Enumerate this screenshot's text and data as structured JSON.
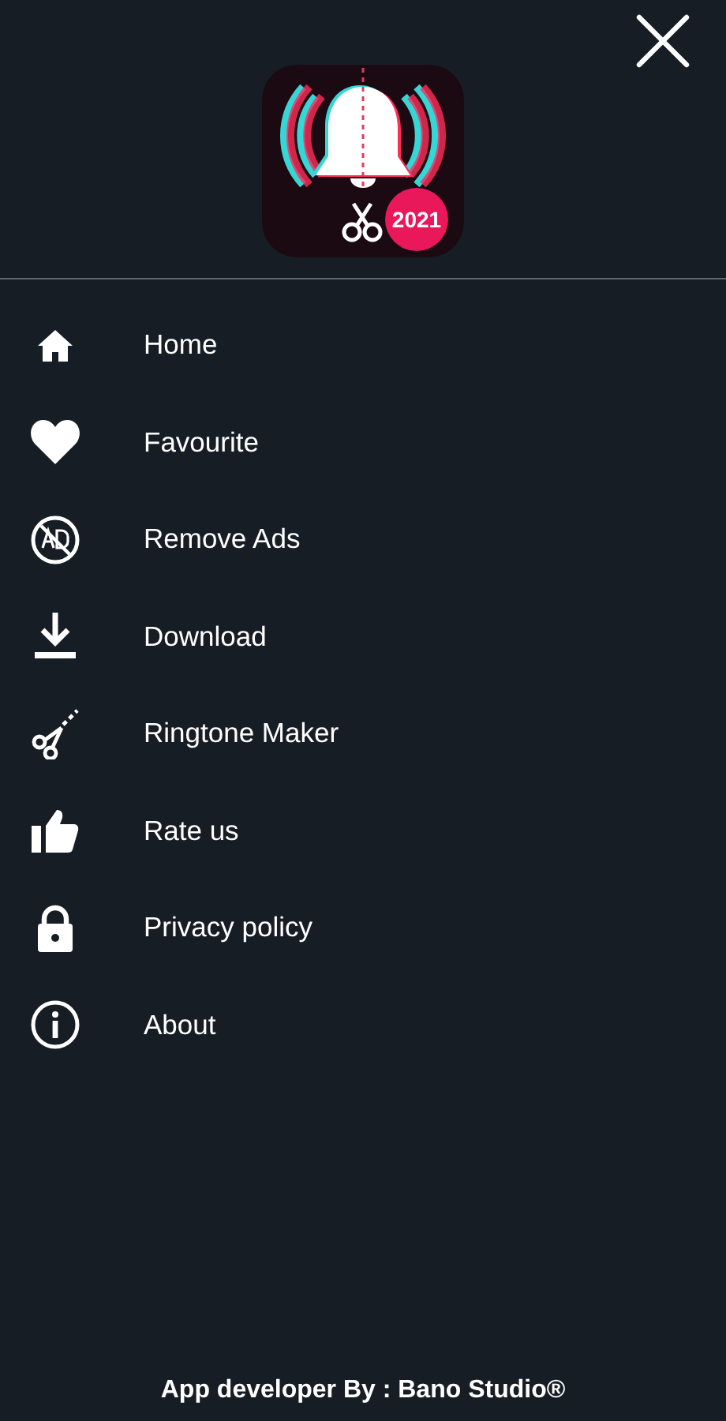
{
  "logo": {
    "badge": "2021"
  },
  "menu": [
    {
      "kind": "home",
      "label": "Home"
    },
    {
      "kind": "heart",
      "label": "Favourite"
    },
    {
      "kind": "noads",
      "label": "Remove Ads"
    },
    {
      "kind": "download",
      "label": "Download"
    },
    {
      "kind": "scissors",
      "label": "Ringtone Maker"
    },
    {
      "kind": "thumb",
      "label": "Rate us"
    },
    {
      "kind": "lock",
      "label": "Privacy policy"
    },
    {
      "kind": "info",
      "label": "About"
    }
  ],
  "footer": "App developer By : Bano Studio®"
}
